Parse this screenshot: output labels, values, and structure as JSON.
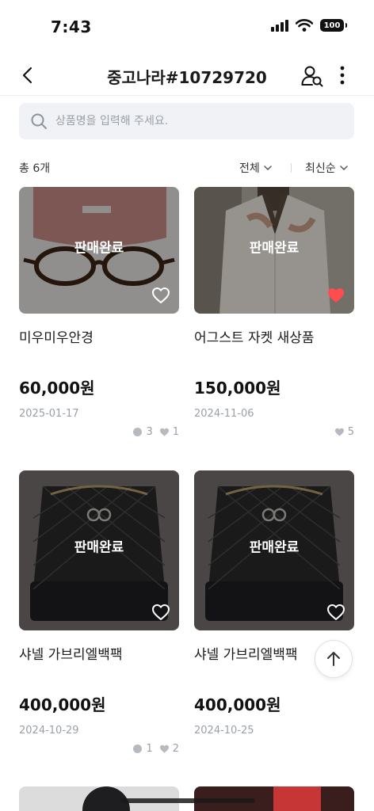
{
  "status": {
    "time": "7:43",
    "battery": "100"
  },
  "header": {
    "title": "중고나라#10729720"
  },
  "search": {
    "placeholder": "상품명을 입력해 주세요."
  },
  "list": {
    "total_label": "총 6개",
    "filter_label": "전체",
    "sort_label": "최신순"
  },
  "products": [
    {
      "title": "미우미우안경",
      "price": "60,000원",
      "date": "2025-01-17",
      "status": "판매완료",
      "chats": "3",
      "likes": "1",
      "liked": false
    },
    {
      "title": "어그스트 자켓 새상품",
      "price": "150,000원",
      "date": "2024-11-06",
      "status": "판매완료",
      "chats": "",
      "likes": "5",
      "liked": true
    },
    {
      "title": "샤넬 가브리엘백팩",
      "price": "400,000원",
      "date": "2024-10-29",
      "status": "판매완료",
      "chats": "1",
      "likes": "2",
      "liked": false
    },
    {
      "title": "샤넬 가브리엘백팩",
      "price": "400,000원",
      "date": "2024-10-25",
      "status": "판매완료",
      "chats": "",
      "likes": "",
      "liked": false
    }
  ],
  "colors": {
    "heart_active": "#ff4d4d",
    "meta_gray": "#9aa0a8"
  }
}
